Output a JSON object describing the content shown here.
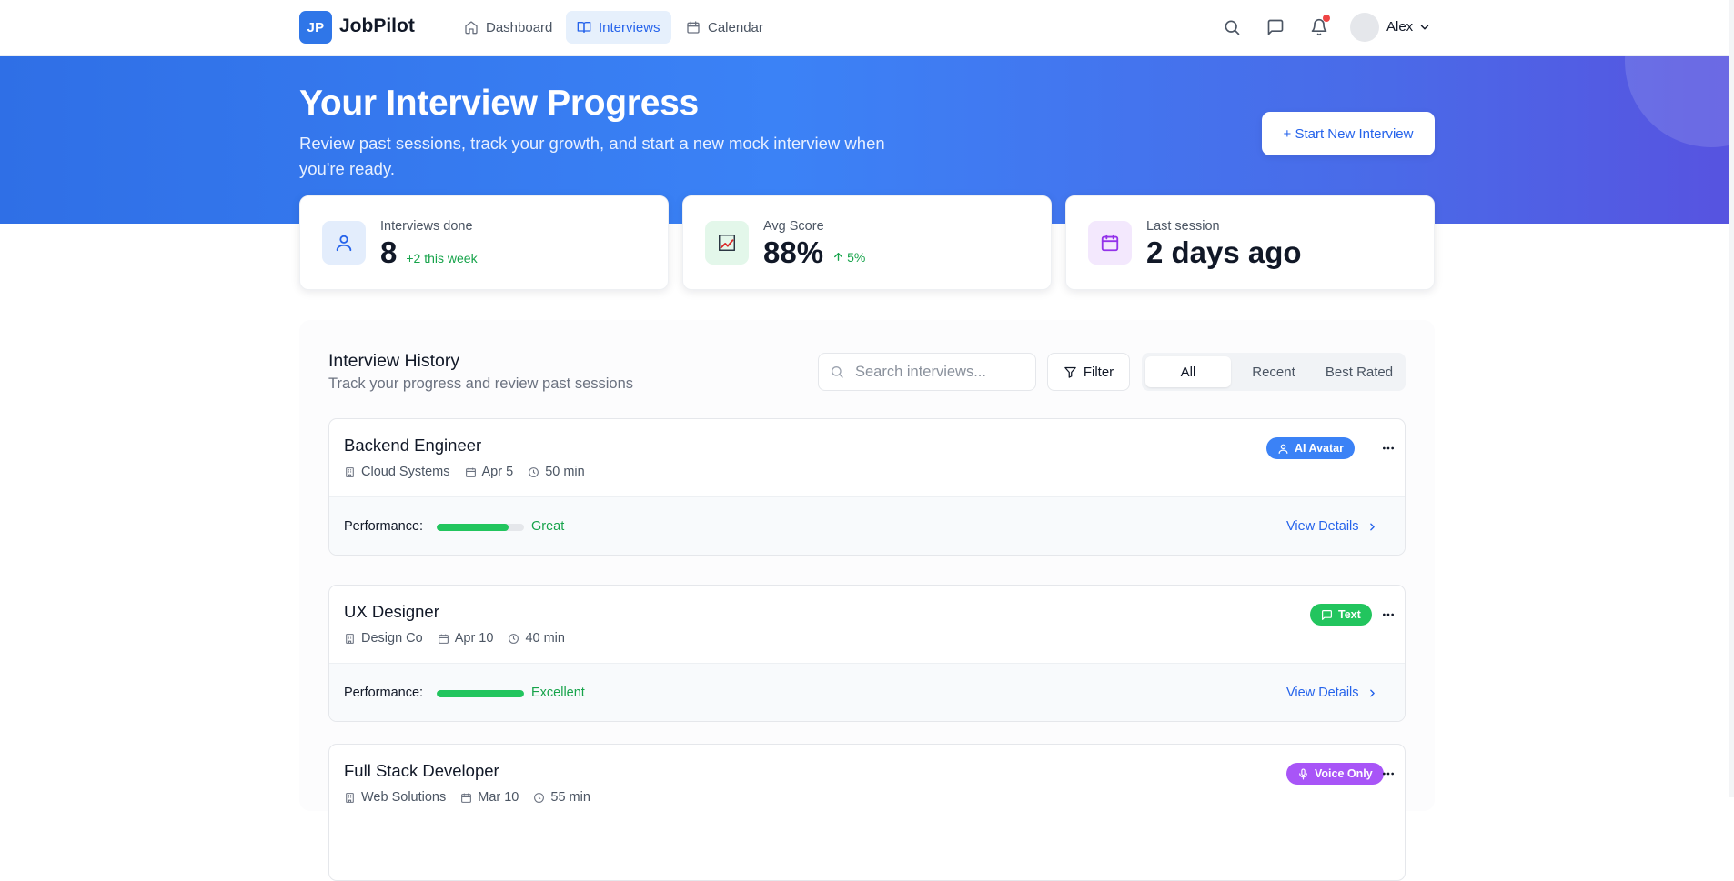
{
  "app": {
    "logo_initials": "JP",
    "name": "JobPilot"
  },
  "nav": {
    "links": [
      {
        "label": "Dashboard",
        "icon": "home-icon"
      },
      {
        "label": "Interviews",
        "icon": "book-icon",
        "active": true
      },
      {
        "label": "Calendar",
        "icon": "calendar-icon"
      }
    ],
    "user_name": "Alex",
    "has_notification": true
  },
  "hero": {
    "title": "Your Interview Progress",
    "subtitle": "Review past sessions, track your growth, and start a new mock interview when you're ready.",
    "cta_label": "+ Start New Interview"
  },
  "stats": [
    {
      "label": "Interviews done",
      "value": "8",
      "delta": "+2 this week",
      "icon": "user-icon",
      "color": "#2563eb",
      "bg": "#e3edfc"
    },
    {
      "label": "Avg Score",
      "value": "88%",
      "delta": "5%",
      "icon": "chart-icon",
      "color": "#dc2626",
      "bg": "#e3f7ea"
    },
    {
      "label": "Last session",
      "value": "2 days ago",
      "delta": "",
      "icon": "calendar-icon",
      "color": "#9333ea",
      "bg": "#f3e8fd"
    }
  ],
  "history": {
    "title": "Interview History",
    "subtitle": "Track your progress and review past sessions",
    "search_placeholder": "Search interviews...",
    "filter_label": "Filter",
    "segments": [
      "All",
      "Recent",
      "Best Rated"
    ],
    "active_segment": "All",
    "perf_label": "Performance:",
    "view_label": "View Details",
    "items": [
      {
        "title": "Backend Engineer",
        "company": "Cloud Systems",
        "date": "Apr 5",
        "duration": "50 min",
        "badge": "AI Avatar",
        "badge_icon": "user-icon",
        "badge_color": "#3b82f6",
        "performance": "Great",
        "performance_fraction": 0.82
      },
      {
        "title": "UX Designer",
        "company": "Design Co",
        "date": "Apr 10",
        "duration": "40 min",
        "badge": "Text",
        "badge_icon": "message-icon",
        "badge_color": "#22c55e",
        "performance": "Excellent",
        "performance_fraction": 1.0
      },
      {
        "title": "Full Stack Developer",
        "company": "Web Solutions",
        "date": "Mar 10",
        "duration": "55 min",
        "badge": "Voice Only",
        "badge_icon": "mic-icon",
        "badge_color": "#a855f7",
        "performance": "",
        "performance_fraction": 0
      }
    ]
  }
}
